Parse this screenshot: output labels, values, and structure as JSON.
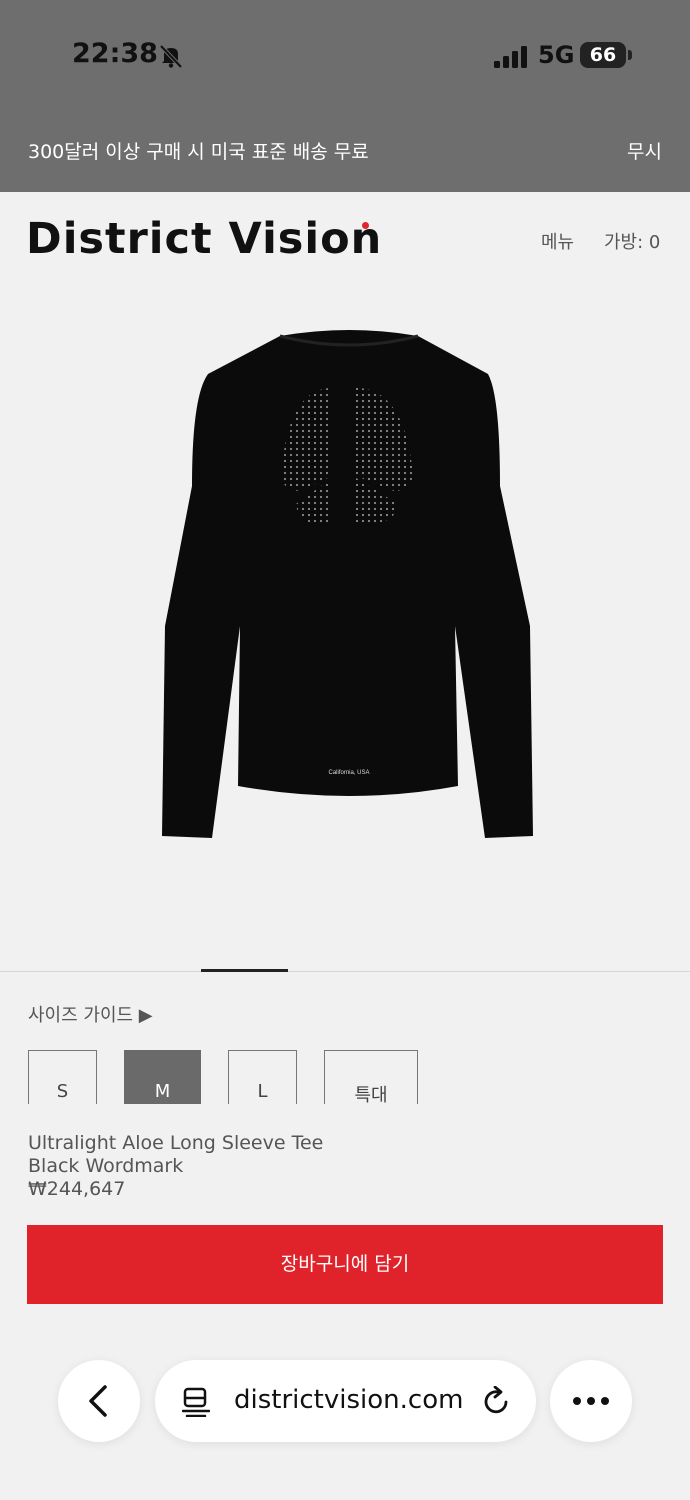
{
  "status_bar": {
    "time": "22:38",
    "network": "5G",
    "battery": "66"
  },
  "promo": {
    "text": "300달러 이상 구매 시 미국 표준 배송 무료",
    "dismiss": "무시"
  },
  "header": {
    "logo": "District Vision",
    "menu": "메뉴",
    "cart": "가방: 0"
  },
  "product_image": {
    "print_text": "California, USA"
  },
  "size_guide": "사이즈 가이드 ▶",
  "sizes": [
    {
      "label": "S",
      "selected": false
    },
    {
      "label": "M",
      "selected": true
    },
    {
      "label": "L",
      "selected": false
    },
    {
      "label": "특대",
      "selected": false
    }
  ],
  "product": {
    "name": "Ultralight Aloe Long Sleeve Tee",
    "color": "Black Wordmark",
    "price": "₩244,647"
  },
  "add_to_cart": "장바구니에 담기",
  "browser": {
    "url": "districtvision.com"
  },
  "colors": {
    "accent": "#e0222a",
    "topbar": "#6e6e6e",
    "background": "#f1f1f1"
  }
}
